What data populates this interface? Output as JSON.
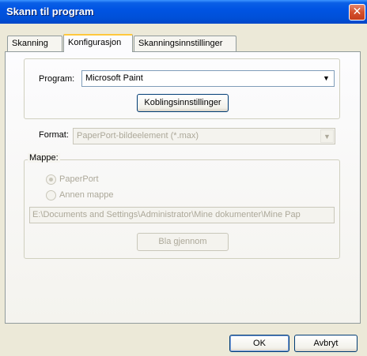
{
  "window": {
    "title": "Skann til program",
    "close_glyph": "✕"
  },
  "tabs": [
    {
      "label": "Skanning",
      "active": false
    },
    {
      "label": "Konfigurasjon",
      "active": true
    },
    {
      "label": "Skanningsinnstillinger",
      "active": false
    }
  ],
  "program": {
    "label": "Program:",
    "value": "Microsoft Paint",
    "link_button": "Koblingsinnstillinger"
  },
  "format": {
    "label": "Format:",
    "value": "PaperPort-bildeelement (*.max)",
    "enabled": false
  },
  "folder": {
    "group_label": "Mappe:",
    "options": [
      {
        "label": "PaperPort",
        "selected": true,
        "enabled": false
      },
      {
        "label": "Annen mappe",
        "selected": false,
        "enabled": false
      }
    ],
    "path": "E:\\Documents and Settings\\Administrator\\Mine dokumenter\\Mine Pap",
    "browse_button": "Bla gjennom"
  },
  "footer": {
    "ok_label": "OK",
    "cancel_label": "Avbryt"
  },
  "icons": {
    "dropdown_arrow": "▼"
  },
  "colors": {
    "titlebar": "#0054e3",
    "active_tab_accent": "#ffc83c",
    "disabled_text": "#aca899"
  }
}
